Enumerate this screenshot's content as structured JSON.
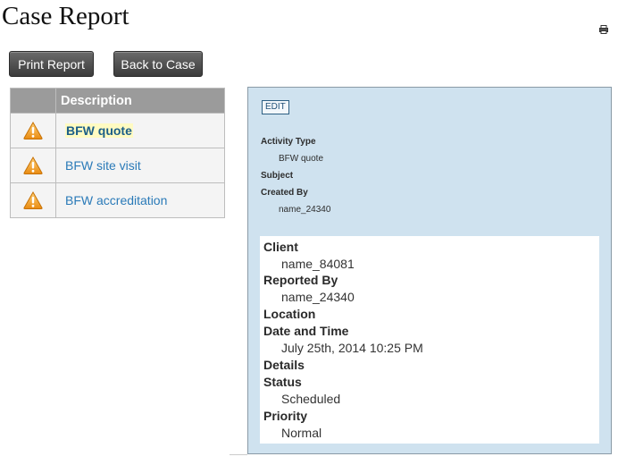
{
  "page": {
    "title": "Case Report"
  },
  "toolbar": {
    "print_report_label": "Print Report",
    "back_to_case_label": "Back to Case",
    "print_icon": "printer-icon"
  },
  "activities": {
    "header": "Description",
    "rows": [
      {
        "label": "BFW quote",
        "icon": "warning-icon",
        "selected": true
      },
      {
        "label": "BFW site visit",
        "icon": "warning-icon",
        "selected": false
      },
      {
        "label": "BFW accreditation",
        "icon": "warning-icon",
        "selected": false
      }
    ]
  },
  "detail": {
    "edit_label": "EDIT",
    "activity_type_label": "Activity Type",
    "activity_type_value": "BFW quote",
    "subject_label": "Subject",
    "created_by_label": "Created By",
    "created_by_value": "name_24340",
    "case": {
      "client_label": "Client",
      "client_value": "name_84081",
      "reported_by_label": "Reported By",
      "reported_by_value": "name_24340",
      "location_label": "Location",
      "date_time_label": "Date and Time",
      "date_time_value": "July 25th, 2014 10:25 PM",
      "details_label": "Details",
      "status_label": "Status",
      "status_value": "Scheduled",
      "priority_label": "Priority",
      "priority_value": "Normal"
    }
  },
  "colors": {
    "panel_bg": "#cfe2ef",
    "link": "#2a7ab8",
    "warning": "#f0a020"
  }
}
